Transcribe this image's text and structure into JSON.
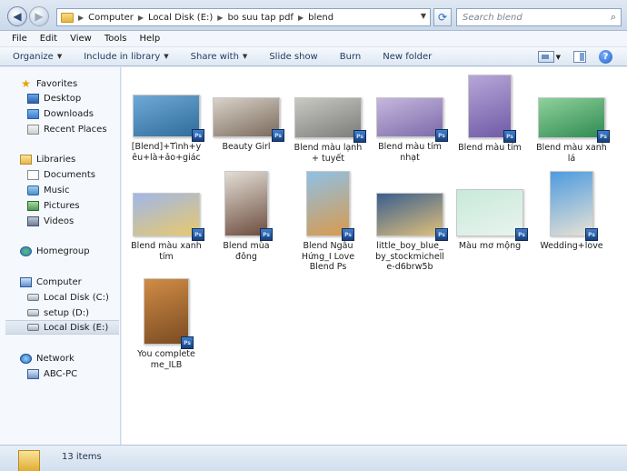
{
  "address_bar": {
    "back_glyph": "◀",
    "forward_glyph": "▶",
    "path": [
      "Computer",
      "Local Disk (E:)",
      "bo suu tap pdf",
      "blend"
    ],
    "search_placeholder": "Search blend"
  },
  "menu": [
    "File",
    "Edit",
    "View",
    "Tools",
    "Help"
  ],
  "toolbar": {
    "organize": "Organize",
    "include_in_library": "Include in library",
    "share_with": "Share with",
    "slide_show": "Slide show",
    "burn": "Burn",
    "new_folder": "New folder",
    "help": "?"
  },
  "navigation": {
    "favorites": {
      "label": "Favorites",
      "items": [
        "Desktop",
        "Downloads",
        "Recent Places"
      ]
    },
    "libraries": {
      "label": "Libraries",
      "items": [
        "Documents",
        "Music",
        "Pictures",
        "Videos"
      ]
    },
    "homegroup": "Homegroup",
    "computer": {
      "label": "Computer",
      "items": [
        "Local Disk (C:)",
        "setup (D:)",
        "Local Disk (E:)"
      ],
      "selected": "Local Disk (E:)"
    },
    "network": {
      "label": "Network",
      "items": [
        "ABC-PC"
      ]
    }
  },
  "files": [
    {
      "name": "[Blend]+Tình+yêu+là+ảo+giác",
      "colors": [
        "#6fa9d8",
        "#2f6c9a"
      ]
    },
    {
      "name": "Beauty Girl",
      "colors": [
        "#d9d2c8",
        "#7a6a5c"
      ]
    },
    {
      "name": "Blend màu lạnh + tuyết",
      "colors": [
        "#c9c9c4",
        "#7b7d78"
      ]
    },
    {
      "name": "Blend màu tím nhạt",
      "colors": [
        "#c6b7df",
        "#7c6aa8"
      ]
    },
    {
      "name": "Blend màu tím",
      "colors": [
        "#b7a6d8",
        "#6f5aa6"
      ]
    },
    {
      "name": "Blend màu xanh lá",
      "colors": [
        "#8fd19a",
        "#2f8a53"
      ]
    },
    {
      "name": "Blend màu xanh tím",
      "colors": [
        "#a0b7e8",
        "#e8c96b"
      ]
    },
    {
      "name": "Blend mùa đông",
      "colors": [
        "#e3ddd6",
        "#6d4d3e"
      ]
    },
    {
      "name": "Blend Ngẫu Hứng_I Love Blend Ps",
      "colors": [
        "#8fc1e6",
        "#d89a4c"
      ]
    },
    {
      "name": "little_boy_blue_by_stockmichelle-d6brw5b",
      "colors": [
        "#3b5f8e",
        "#e0c07a"
      ]
    },
    {
      "name": "Màu mơ mộng",
      "colors": [
        "#c7ead9",
        "#e9f3ef"
      ]
    },
    {
      "name": "Wedding+love",
      "colors": [
        "#4d9be0",
        "#e7e2d4"
      ]
    },
    {
      "name": "You complete me_ILB",
      "colors": [
        "#d08c45",
        "#7a4b22"
      ]
    }
  ],
  "ps_badge": "Ps",
  "status": {
    "items_count": "13 items"
  }
}
